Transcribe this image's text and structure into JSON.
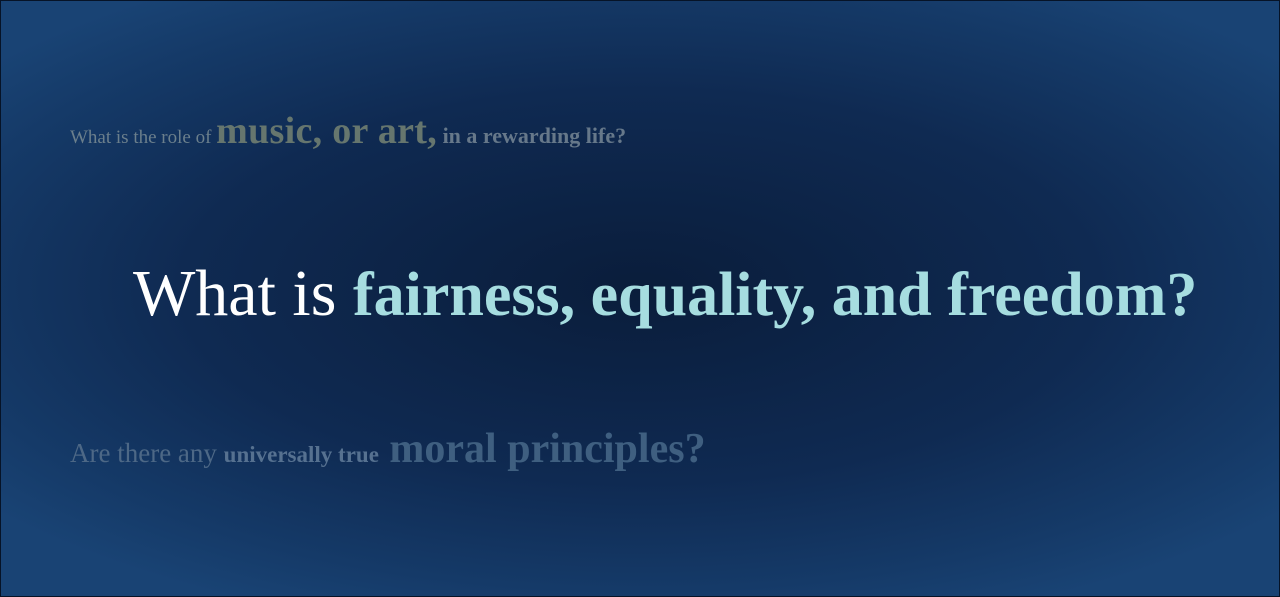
{
  "questions": {
    "top": {
      "part1": "What is the role of ",
      "part2": "music, or art,",
      "part3": " in a rewarding life?"
    },
    "main": {
      "lead": "What is ",
      "highlight": "fairness, equality, and freedom?"
    },
    "bottom": {
      "part1": "Are there any ",
      "part2": "universally true",
      "part3": " moral principles?"
    }
  },
  "colors": {
    "background": "#0b1e3d",
    "main_text": "#ffffff",
    "highlight": "#a6dde0",
    "faded_top": "#6b7f8c",
    "faded_bottom": "#4f6a87"
  }
}
